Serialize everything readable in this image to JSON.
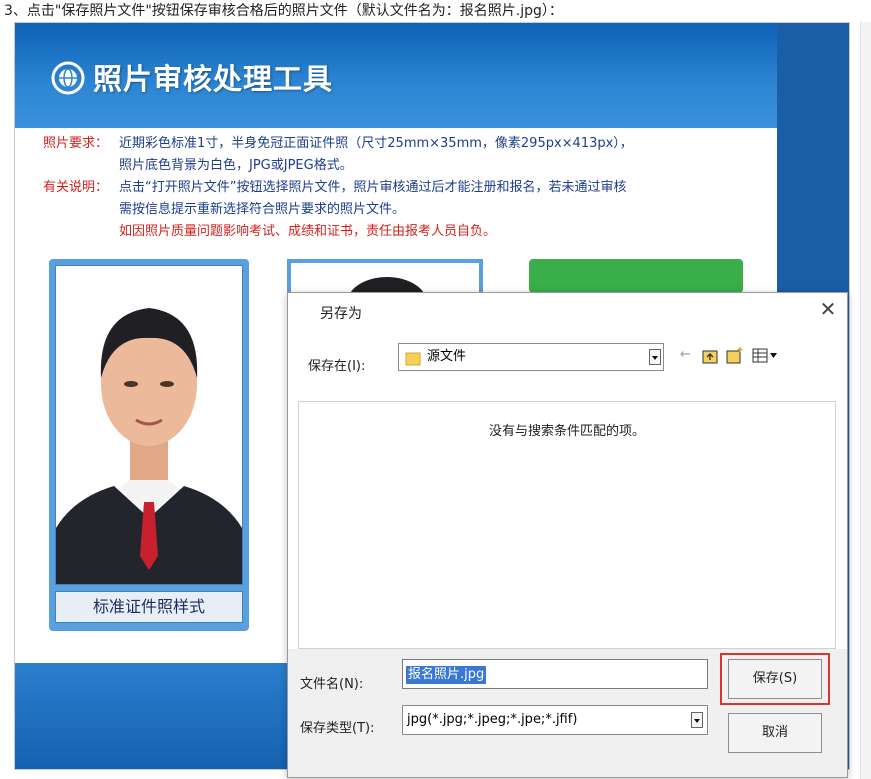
{
  "caption": "3、点击\"保存照片文件\"按钮保存审核合格后的照片文件（默认文件名为：报名照片.jpg）：",
  "app": {
    "title": "照片审核处理工具",
    "req_label": "照片要求：",
    "req_line1": "近期彩色标准1寸，半身免冠正面证件照（尺寸25mm×35mm，像素295px×413px），",
    "req_line2": "照片底色背景为白色，JPG或JPEG格式。",
    "note_label": "有关说明：",
    "note_line1": "点击“打开照片文件”按钮选择照片文件，照片审核通过后才能注册和报名，若未通过审核",
    "note_line2": "需按信息提示重新选择符合照片要求的照片文件。",
    "note_line3": "如因照片质量问题影响考试、成绩和证书，责任由报考人员自负。",
    "sample_caption": "标准证件照样式"
  },
  "dialog": {
    "title": "另存为",
    "save_in_label": "保存在(I):",
    "save_in_value": "源文件",
    "empty_message": "没有与搜索条件匹配的项。",
    "filename_label": "文件名(N):",
    "filename_value": "报名照片.jpg",
    "filetype_label": "保存类型(T):",
    "filetype_value": "jpg(*.jpg;*.jpeg;*.jpe;*.jfif)",
    "save_button": "保存(S)",
    "cancel_button": "取消"
  },
  "colors": {
    "accent_blue": "#1b5ea8",
    "highlight_red": "#d9352f",
    "green": "#3aae49"
  }
}
